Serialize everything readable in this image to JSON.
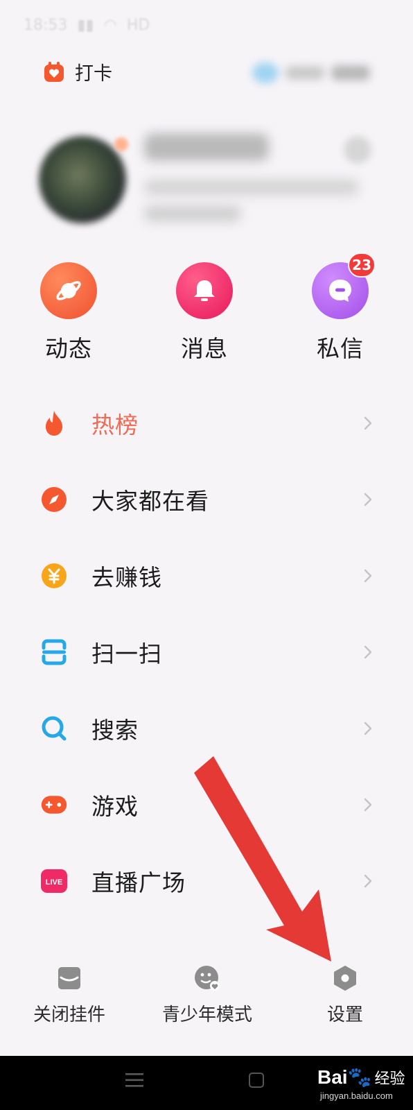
{
  "status_bar": {
    "time": "18:53",
    "network": "HD"
  },
  "header": {
    "checkin_label": "打卡"
  },
  "quick_actions": [
    {
      "label": "动态",
      "icon": "planet-icon",
      "color": "#f5653f"
    },
    {
      "label": "消息",
      "icon": "bell-icon",
      "color": "#f0306a"
    },
    {
      "label": "私信",
      "icon": "chat-icon",
      "color": "#b45cf0",
      "badge": "23"
    }
  ],
  "menu": [
    {
      "label": "热榜",
      "icon": "flame-icon",
      "highlight": true
    },
    {
      "label": "大家都在看",
      "icon": "compass-icon"
    },
    {
      "label": "去赚钱",
      "icon": "yuan-coin-icon"
    },
    {
      "label": "扫一扫",
      "icon": "scan-icon"
    },
    {
      "label": "搜索",
      "icon": "search-icon"
    },
    {
      "label": "游戏",
      "icon": "gamepad-icon"
    },
    {
      "label": "直播广场",
      "icon": "live-icon"
    }
  ],
  "live_badge_text": "LIVE",
  "toolbar": [
    {
      "label": "关闭挂件",
      "icon": "widget-close-icon"
    },
    {
      "label": "青少年模式",
      "icon": "teen-mode-icon"
    },
    {
      "label": "设置",
      "icon": "settings-icon"
    }
  ],
  "watermark": {
    "brand": "Bai",
    "brand_suffix": "经验",
    "url": "jingyan.baidu.com"
  },
  "colors": {
    "accent_red": "#f23a3a",
    "hot_text": "#f06b54",
    "arrow": "#e53935",
    "background": "#f7f4f8"
  }
}
